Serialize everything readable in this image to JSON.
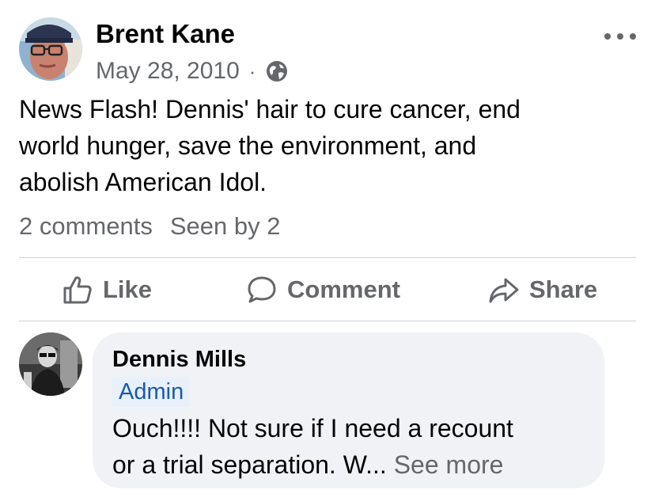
{
  "post": {
    "author": "Brent Kane",
    "date": "May 28, 2010",
    "separator": "·",
    "privacy_icon": "globe-icon",
    "more_icon": "more-options-icon",
    "body_lines": [
      "News Flash!  Dennis' hair to cure cancer, end",
      "world hunger, save the environment, and",
      "abolish American Idol."
    ],
    "comments_count": "2 comments",
    "seen_by": "Seen by 2"
  },
  "actions": {
    "like": "Like",
    "comment": "Comment",
    "share": "Share"
  },
  "comment": {
    "author": "Dennis Mills",
    "badge": "Admin",
    "text_line1": "Ouch!!!! Not sure if I need a recount",
    "text_line2": "or a trial separation.   W...",
    "see_more": "See more"
  },
  "colors": {
    "secondary_text": "#65676b",
    "primary_text": "#050505",
    "bubble_bg": "#f0f2f5",
    "admin_badge_bg": "#e7f0fb",
    "admin_badge_text": "#1b5aa8",
    "divider": "#ced0d4"
  }
}
